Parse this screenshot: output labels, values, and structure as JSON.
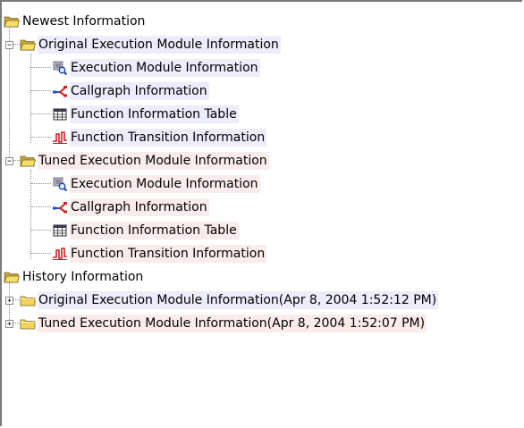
{
  "colors": {
    "original_bg": "#ececfb",
    "tuned_bg": "#fbecec"
  },
  "tree": {
    "newest": {
      "label": "Newest Information",
      "icon": "open-folder-icon",
      "original": {
        "label": "Original Execution Module Information",
        "icon": "open-folder-icon",
        "children": [
          {
            "label": "Execution Module Information",
            "icon": "cpu-magnifier-icon"
          },
          {
            "label": "Callgraph Information",
            "icon": "callgraph-icon"
          },
          {
            "label": "Function Information Table",
            "icon": "table-icon"
          },
          {
            "label": "Function Transition Information",
            "icon": "waveform-icon"
          }
        ]
      },
      "tuned": {
        "label": "Tuned Execution Module Information",
        "icon": "open-folder-icon",
        "children": [
          {
            "label": "Execution Module Information",
            "icon": "cpu-magnifier-icon"
          },
          {
            "label": "Callgraph Information",
            "icon": "callgraph-icon"
          },
          {
            "label": "Function Information Table",
            "icon": "table-icon"
          },
          {
            "label": "Function Transition Information",
            "icon": "waveform-icon"
          }
        ]
      }
    },
    "history": {
      "label": "History Information",
      "icon": "open-folder-icon",
      "items": [
        {
          "label": "Original Execution Module Information(Apr 8, 2004 1:52:12 PM)",
          "icon": "folder-icon"
        },
        {
          "label": "Tuned Execution Module Information(Apr 8, 2004 1:52:07 PM)",
          "icon": "folder-icon"
        }
      ]
    }
  }
}
